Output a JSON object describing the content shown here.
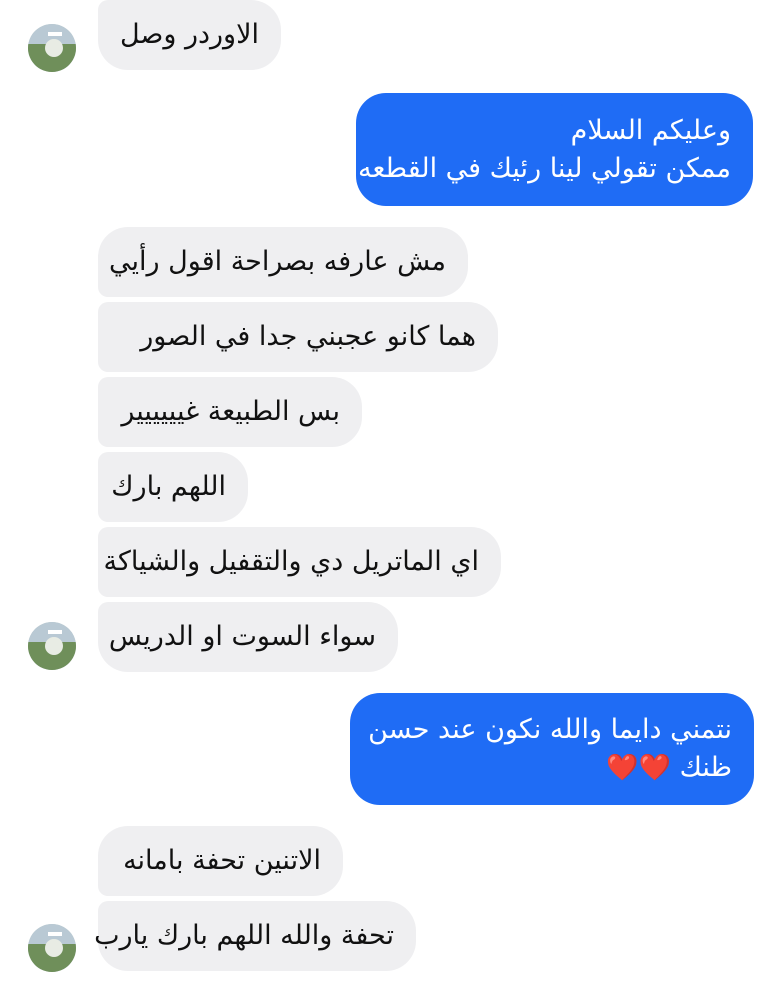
{
  "conversation": {
    "messages": [
      {
        "from": "other",
        "text": "الاوردر وصل"
      },
      {
        "from": "me",
        "lines": [
          "وعليكم السلام",
          "ممكن تقولي لينا رئيك في القطعه"
        ]
      },
      {
        "from": "other",
        "text": "مش عارفه بصراحة اقول رأيي"
      },
      {
        "from": "other",
        "text": "هما كانو عجبني جدا في الصور"
      },
      {
        "from": "other",
        "text": "بس الطبيعة غيييييير"
      },
      {
        "from": "other",
        "text": "اللهم بارك"
      },
      {
        "from": "other",
        "text": "اي الماتريل دي والتقفيل والشياكة"
      },
      {
        "from": "other",
        "text": "سواء السوت او الدريس"
      },
      {
        "from": "me",
        "lines": [
          "نتمني دايما والله نكون عند حسن",
          "ظنك"
        ],
        "emoji": "❤️❤️"
      },
      {
        "from": "other",
        "text": "الاتنين تحفة بامانه"
      },
      {
        "from": "other",
        "text": "تحفة والله اللهم بارك يارب"
      }
    ]
  },
  "colors": {
    "outgoing_bubble": "#1f6cf5",
    "incoming_bubble": "#efeff1",
    "heart": "#e0161f"
  },
  "icons": {
    "avatar": "contact-avatar-icon"
  }
}
